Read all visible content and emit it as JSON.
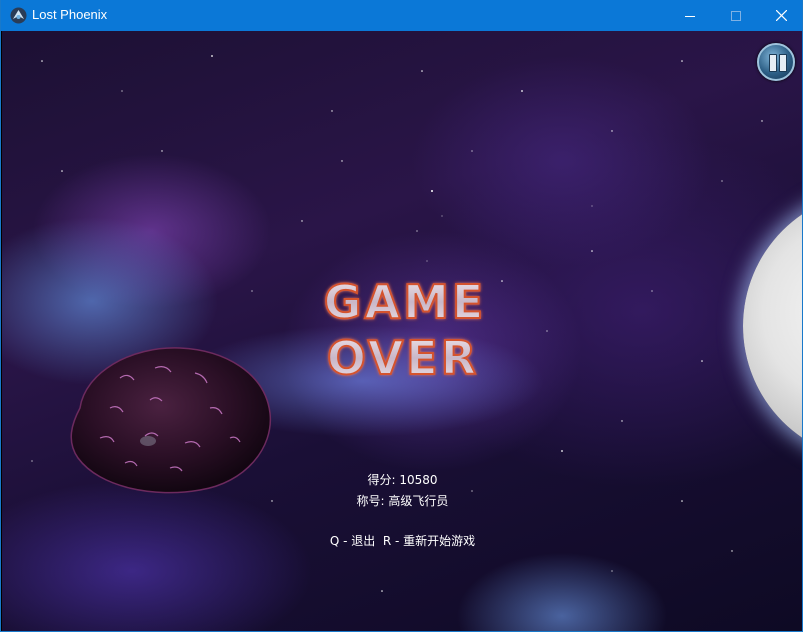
{
  "window": {
    "title": "Lost Phoenix",
    "icon": "phoenix-app-icon",
    "controls": [
      "minimize-icon",
      "maximize-icon",
      "close-icon"
    ]
  },
  "game": {
    "game_over_line1": "GAME",
    "game_over_line2": "OVER",
    "score_label": "得分:",
    "score_value": "10580",
    "rank_label": "称号:",
    "rank_value": "高级飞行员",
    "controls_text": "Q - 退出  R - 重新开始游戏",
    "pause_icon": "pause-icon"
  },
  "colors": {
    "titlebar": "#0b78d7",
    "text": "#ffffff",
    "game_over_fill": "#e7d2d8",
    "game_over_glow": "#d9532f"
  }
}
